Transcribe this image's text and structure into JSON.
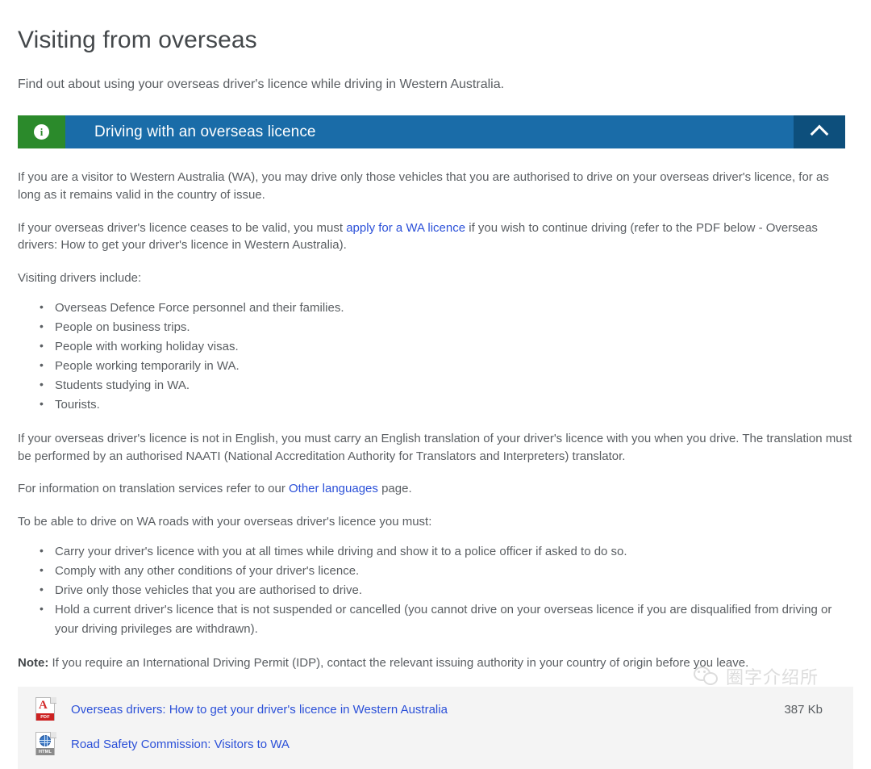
{
  "page": {
    "title": "Visiting from overseas",
    "intro": "Find out about using your overseas driver's licence while driving in Western Australia."
  },
  "accordion": {
    "icon": "info-icon",
    "icon_glyph": "i",
    "title": "Driving with an overseas licence",
    "toggle_icon": "chevron-up-icon",
    "expanded": true,
    "colors": {
      "icon_box": "#2b8a2b",
      "header": "#1a6ca8",
      "toggle_box": "#0d4f7c",
      "link": "#2b50d8"
    }
  },
  "content": {
    "p1": "If you are a visitor to Western Australia (WA), you may drive only those vehicles that you are authorised to drive on your overseas driver's licence, for as long as it remains valid in the country of issue.",
    "p2_before": "If your overseas driver's licence ceases to be valid, you must ",
    "p2_link": "apply for a WA licence",
    "p2_after": " if you wish to continue driving (refer to the PDF below - Overseas drivers: How to get your driver's licence in Western Australia).",
    "p3": "Visiting drivers include:",
    "list1": [
      "Overseas Defence Force personnel and their families.",
      "People on business trips.",
      "People with working holiday visas.",
      "People working temporarily in WA.",
      "Students studying in WA.",
      "Tourists."
    ],
    "p4": "If your overseas driver's licence is not in English, you must carry an English translation of your driver's licence with you when you drive. The translation must be performed by an authorised NAATI (National Accreditation Authority for Translators and Interpreters) translator.",
    "p5_before": "For information on translation services refer to our ",
    "p5_link": "Other languages",
    "p5_after": " page.",
    "p6": "To be able to drive on WA roads with your overseas driver's licence you must:",
    "list2": [
      "Carry your driver's licence with you at all times while driving and show it to a police officer if asked to do so.",
      "Comply with any other conditions of your driver's licence.",
      "Drive only those vehicles that you are authorised to drive.",
      "Hold a current driver's licence that is not suspended or cancelled (you cannot drive on your overseas licence if you are disqualified from driving or your driving privileges are withdrawn)."
    ],
    "note_label": "Note:",
    "note_text": " If you require an International Driving Permit (IDP), contact the relevant issuing authority in your country of origin before you leave."
  },
  "files": [
    {
      "icon": "pdf-file-icon",
      "type_label": "PDF",
      "name": "Overseas drivers: How to get your driver's licence in Western Australia",
      "size": "387 Kb"
    },
    {
      "icon": "html-file-icon",
      "type_label": "HTML",
      "name": "Road Safety Commission: Visitors to WA",
      "size": ""
    }
  ],
  "watermark": {
    "logo": "wechat-logo",
    "text": "圈字介绍所"
  }
}
